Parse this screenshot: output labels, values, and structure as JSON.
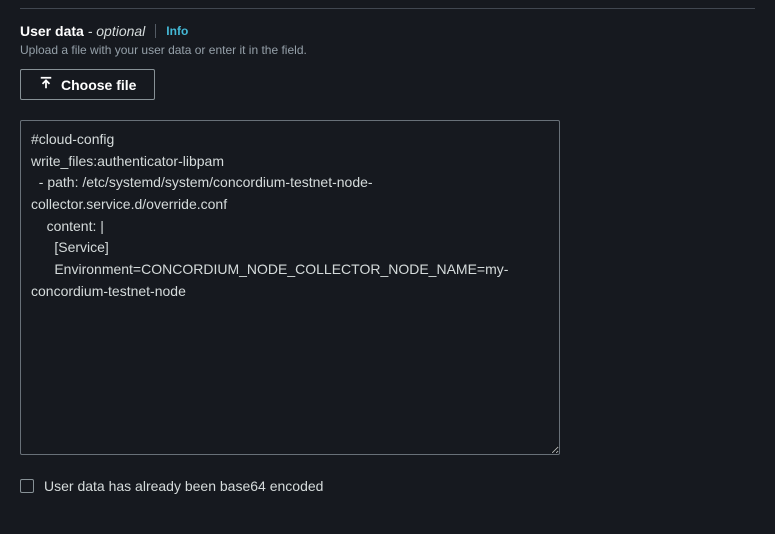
{
  "header": {
    "label": "User data",
    "optional": " - optional",
    "info": "Info",
    "description": "Upload a file with your user data or enter it in the field."
  },
  "buttons": {
    "choose_file": "Choose file"
  },
  "userdata": {
    "text": "#cloud-config\nwrite_files:authenticator-libpam\n  - path: /etc/systemd/system/concordium-testnet-node-collector.service.d/override.conf\n    content: |\n      [Service]\n      Environment=CONCORDIUM_NODE_COLLECTOR_NODE_NAME=my-concordium-testnet-node"
  },
  "checkbox": {
    "label": "User data has already been base64 encoded",
    "checked": false
  }
}
